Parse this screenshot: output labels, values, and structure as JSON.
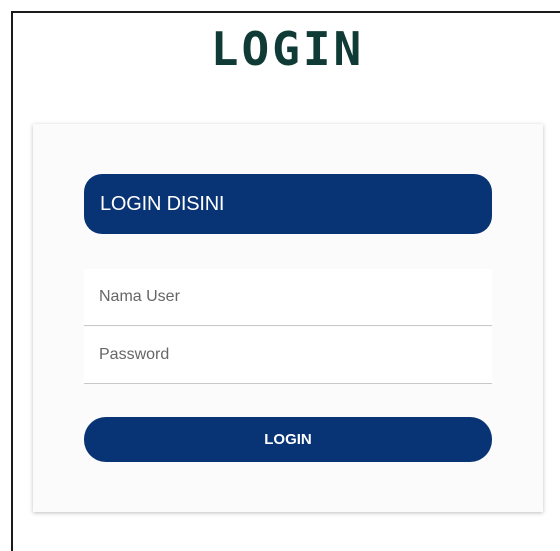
{
  "page": {
    "title": "LOGIN"
  },
  "card": {
    "header": "LOGIN DISINI",
    "username_field": {
      "placeholder": "Nama User",
      "value": ""
    },
    "password_field": {
      "placeholder": "Password",
      "value": ""
    },
    "submit_label": "LOGIN"
  },
  "colors": {
    "title": "#0f3a35",
    "primary": "#083374",
    "card_background": "#fbfbfb"
  }
}
